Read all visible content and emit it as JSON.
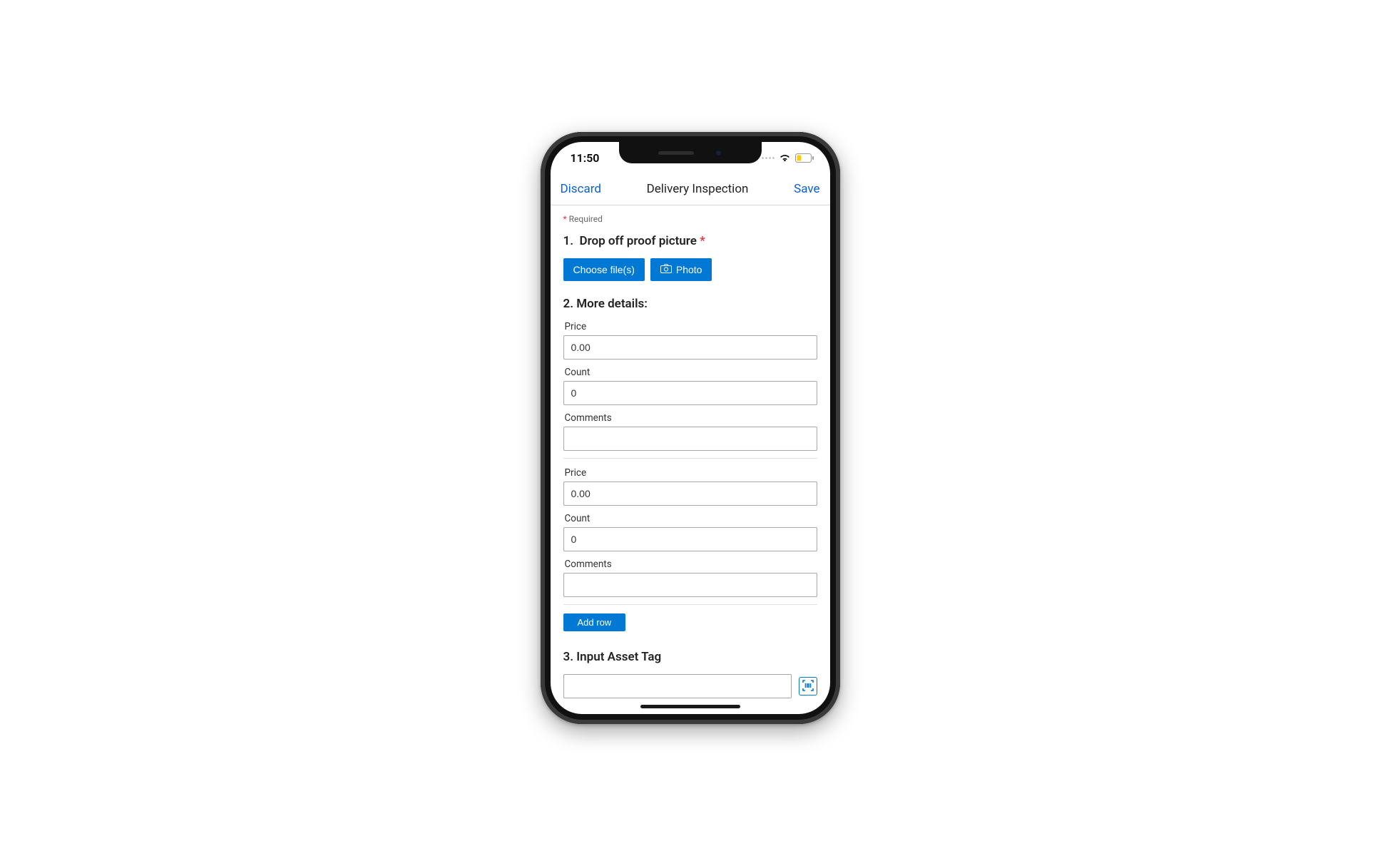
{
  "status": {
    "time": "11:50"
  },
  "nav": {
    "discard_label": "Discard",
    "title": "Delivery Inspection",
    "save_label": "Save"
  },
  "form": {
    "required_hint": "Required",
    "q1": {
      "number": "1.",
      "title": "Drop off proof picture",
      "choose_label": "Choose file(s)",
      "photo_label": "Photo"
    },
    "q2": {
      "number": "2.",
      "title": "More details:",
      "labels": {
        "price": "Price",
        "count": "Count",
        "comments": "Comments"
      },
      "rows": [
        {
          "price": "0.00",
          "count": "0",
          "comments": ""
        },
        {
          "price": "0.00",
          "count": "0",
          "comments": ""
        }
      ],
      "add_row_label": "Add row"
    },
    "q3": {
      "number": "3.",
      "title": "Input Asset Tag",
      "value": ""
    }
  }
}
